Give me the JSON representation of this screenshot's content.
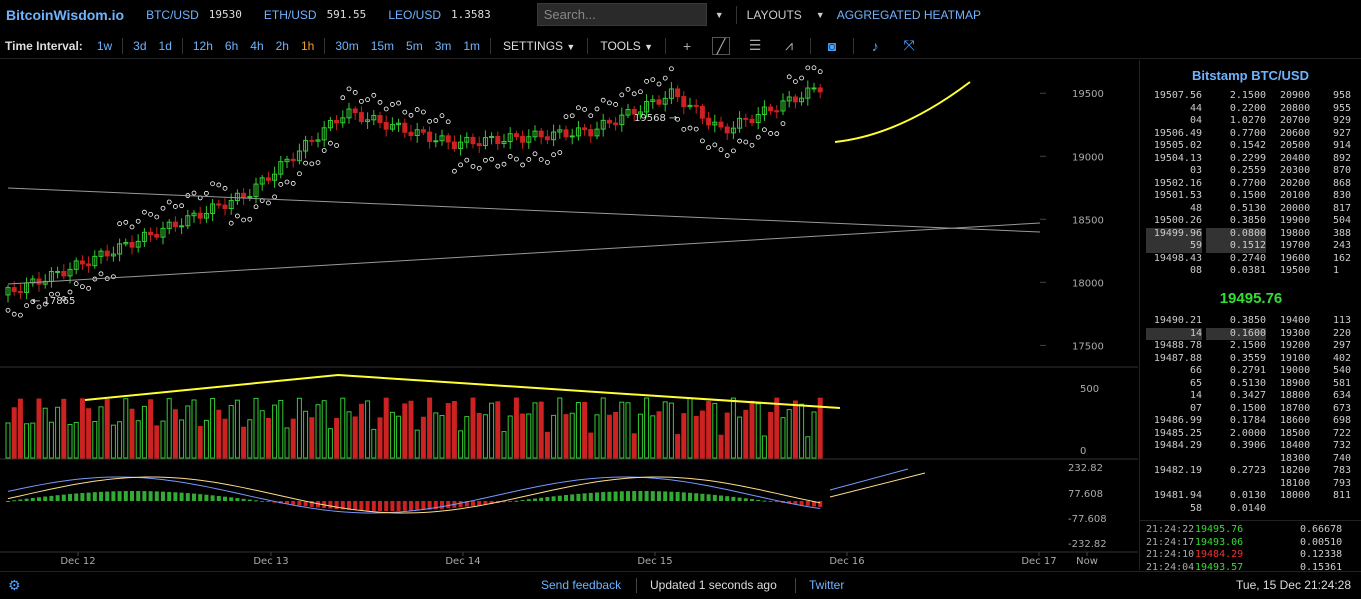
{
  "header": {
    "logo": "BitcoinWisdom.io",
    "tickers": [
      {
        "pair": "BTC/USD",
        "price": "19530"
      },
      {
        "pair": "ETH/USD",
        "price": "591.55"
      },
      {
        "pair": "LEO/USD",
        "price": "1.3583"
      }
    ],
    "search_placeholder": "Search...",
    "layouts_label": "LAYOUTS",
    "heatmap_label": "AGGREGATED HEATMAP"
  },
  "toolbar": {
    "time_interval_label": "Time Interval:",
    "intervals_a": [
      "1w",
      "3d",
      "1d"
    ],
    "intervals_b": [
      "12h",
      "6h",
      "4h",
      "2h",
      "1h"
    ],
    "intervals_c": [
      "30m",
      "15m",
      "5m",
      "3m",
      "1m"
    ],
    "active_interval": "1h",
    "settings_label": "SETTINGS",
    "tools_label": "TOOLS",
    "icons": [
      "crosshair-icon",
      "trendline-icon",
      "horizontal-lines-icon",
      "fan-icon",
      "camera-icon",
      "bell-icon",
      "fullscreen-icon"
    ]
  },
  "chart_data": {
    "type": "candlestick",
    "price_axis": [
      "19500",
      "19000",
      "18500",
      "18000",
      "17500"
    ],
    "ylim": [
      17400,
      19700
    ],
    "volume_axis": [
      "500",
      "0"
    ],
    "macd_axis": [
      "232.82",
      "77.608",
      "-77.608",
      "-232.82"
    ],
    "x_ticks": [
      "Dec 12",
      "Dec 13",
      "Dec 14",
      "Dec 15",
      "Dec 16",
      "Dec 17",
      "Now"
    ],
    "annotations": {
      "high": "19568 →",
      "low": "← 17865"
    },
    "colors": {
      "up": "#33cc33",
      "down": "#cc2222",
      "sar": "#ffffff",
      "trend": "#ffff33",
      "line": "#888888",
      "macd": "#7799ff",
      "signal": "#ffdd88"
    }
  },
  "orderbook": {
    "title": "Bitstamp BTC/USD",
    "asks": [
      {
        "price": "19507.56",
        "amount": "2.1500"
      },
      {
        "price": "44",
        "amount": "0.2200"
      },
      {
        "price": "04",
        "amount": "1.0270"
      },
      {
        "price": "19506.49",
        "amount": "0.7700"
      },
      {
        "price": "19505.02",
        "amount": "0.1542"
      },
      {
        "price": "19504.13",
        "amount": "0.2299"
      },
      {
        "price": "03",
        "amount": "0.2559"
      },
      {
        "price": "19502.16",
        "amount": "0.7700"
      },
      {
        "price": "19501.53",
        "amount": "0.1500"
      },
      {
        "price": "48",
        "amount": "0.5130"
      },
      {
        "price": "19500.26",
        "amount": "0.3850"
      },
      {
        "price": "19499.96",
        "amount": "0.0800"
      },
      {
        "price": "59",
        "amount": "0.1512"
      },
      {
        "price": "19498.43",
        "amount": "0.2740"
      },
      {
        "price": "08",
        "amount": "0.0381"
      }
    ],
    "ask_depth": [
      {
        "price": "20900",
        "vol": "958"
      },
      {
        "price": "20800",
        "vol": "955"
      },
      {
        "price": "20700",
        "vol": "929"
      },
      {
        "price": "20600",
        "vol": "927"
      },
      {
        "price": "20500",
        "vol": "914"
      },
      {
        "price": "20400",
        "vol": "892"
      },
      {
        "price": "20300",
        "vol": "870"
      },
      {
        "price": "20200",
        "vol": "868"
      },
      {
        "price": "20100",
        "vol": "830"
      },
      {
        "price": "20000",
        "vol": "817"
      },
      {
        "price": "19900",
        "vol": "504"
      },
      {
        "price": "19800",
        "vol": "388"
      },
      {
        "price": "19700",
        "vol": "243"
      },
      {
        "price": "19600",
        "vol": "162"
      },
      {
        "price": "19500",
        "vol": "1"
      }
    ],
    "last_price": "19495.76",
    "bids": [
      {
        "price": "19490.21",
        "amount": "0.3850"
      },
      {
        "price": "14",
        "amount": "0.1600"
      },
      {
        "price": "19488.78",
        "amount": "2.1500"
      },
      {
        "price": "19487.88",
        "amount": "0.3559"
      },
      {
        "price": "66",
        "amount": "0.2791"
      },
      {
        "price": "65",
        "amount": "0.5130"
      },
      {
        "price": "14",
        "amount": "0.3427"
      },
      {
        "price": "07",
        "amount": "0.1500"
      },
      {
        "price": "19486.99",
        "amount": "0.1784"
      },
      {
        "price": "19485.25",
        "amount": "2.0000"
      },
      {
        "price": "19484.29",
        "amount": "0.3906"
      },
      {
        "price": "",
        "amount": ""
      },
      {
        "price": "19482.19",
        "amount": "0.2723"
      },
      {
        "price": "",
        "amount": ""
      },
      {
        "price": "19481.94",
        "amount": "0.0130"
      },
      {
        "price": "58",
        "amount": "0.0140"
      }
    ],
    "bid_depth": [
      {
        "price": "19400",
        "vol": "113"
      },
      {
        "price": "19300",
        "vol": "220"
      },
      {
        "price": "19200",
        "vol": "297"
      },
      {
        "price": "19100",
        "vol": "402"
      },
      {
        "price": "19000",
        "vol": "540"
      },
      {
        "price": "18900",
        "vol": "581"
      },
      {
        "price": "18800",
        "vol": "634"
      },
      {
        "price": "18700",
        "vol": "673"
      },
      {
        "price": "18600",
        "vol": "698"
      },
      {
        "price": "18500",
        "vol": "722"
      },
      {
        "price": "18400",
        "vol": "732"
      },
      {
        "price": "18300",
        "vol": "740"
      },
      {
        "price": "18200",
        "vol": "783"
      },
      {
        "price": "18100",
        "vol": "793"
      },
      {
        "price": "18000",
        "vol": "811"
      }
    ],
    "trades": [
      {
        "time": "21:24:22",
        "price": "19495.76",
        "amount": "0.66678",
        "dir": "up"
      },
      {
        "time": "21:24:17",
        "price": "19493.06",
        "amount": "0.00510",
        "dir": "up"
      },
      {
        "time": "21:24:10",
        "price": "19484.29",
        "amount": "0.12338",
        "dir": "dn"
      },
      {
        "time": "21:24:04",
        "price": "19493.57",
        "amount": "0.15361",
        "dir": "up"
      }
    ]
  },
  "statusbar": {
    "feedback": "Send feedback",
    "updated": "Updated 1 seconds ago",
    "twitter": "Twitter",
    "datetime": "Tue, 15 Dec 21:24:28"
  }
}
